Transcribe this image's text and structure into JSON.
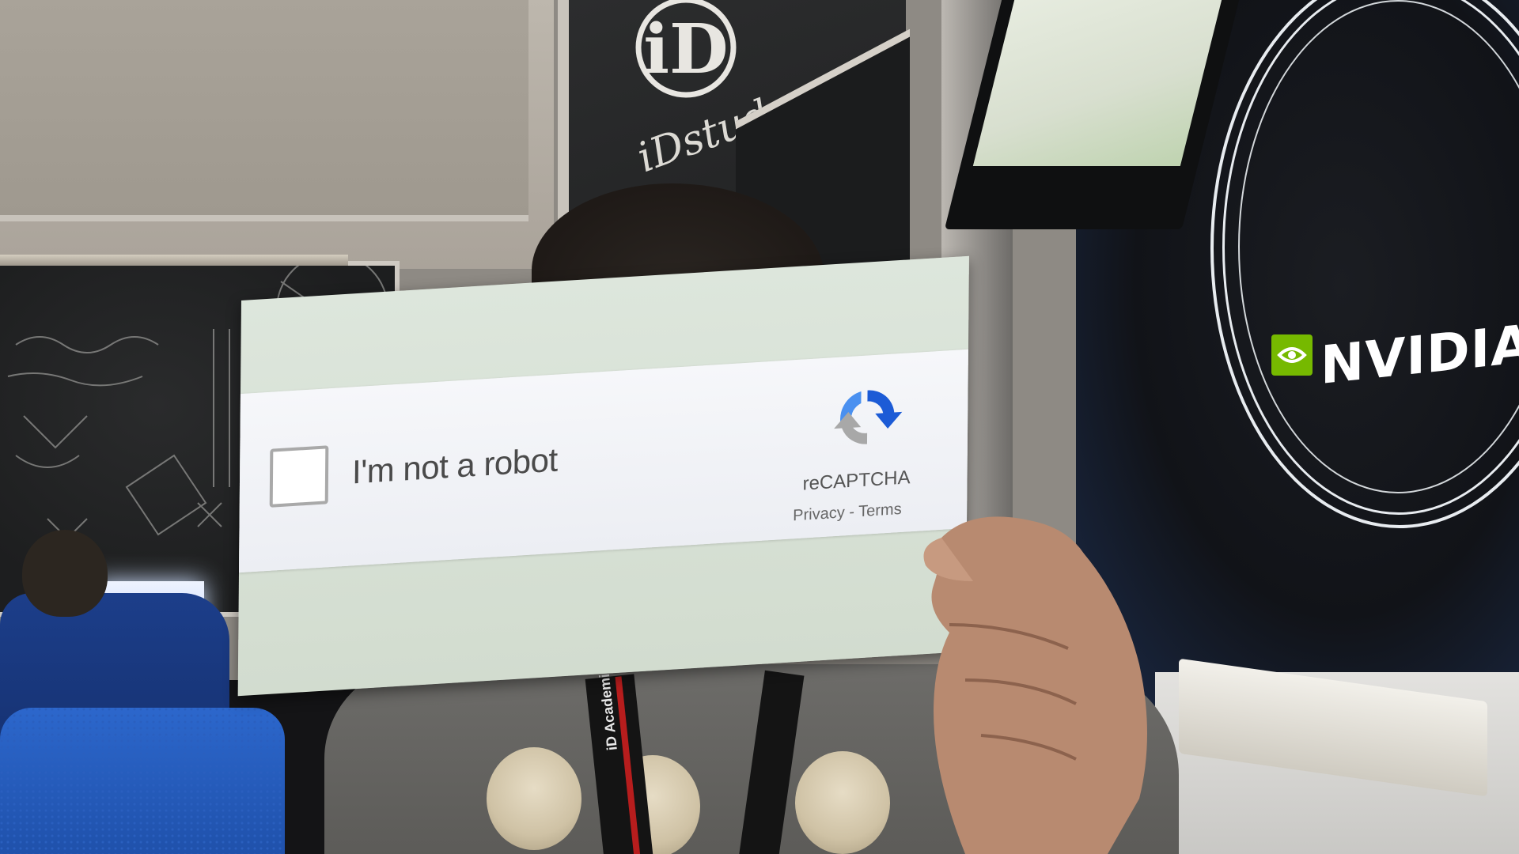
{
  "captcha": {
    "checkbox_label": "I'm not a robot",
    "brand": "reCAPTCHA",
    "links": "Privacy - Terms",
    "checked": false
  },
  "background": {
    "board_logo_text": "iD",
    "board_text": "iDstudent",
    "poster_brand": "NVIDIA",
    "lanyard_text": "iD Academies"
  },
  "colors": {
    "nvidia_green": "#76b900",
    "recaptcha_blue": "#1c5bd6",
    "recaptcha_grey": "#a8a8a8",
    "chair_blue": "#2c67cc"
  }
}
